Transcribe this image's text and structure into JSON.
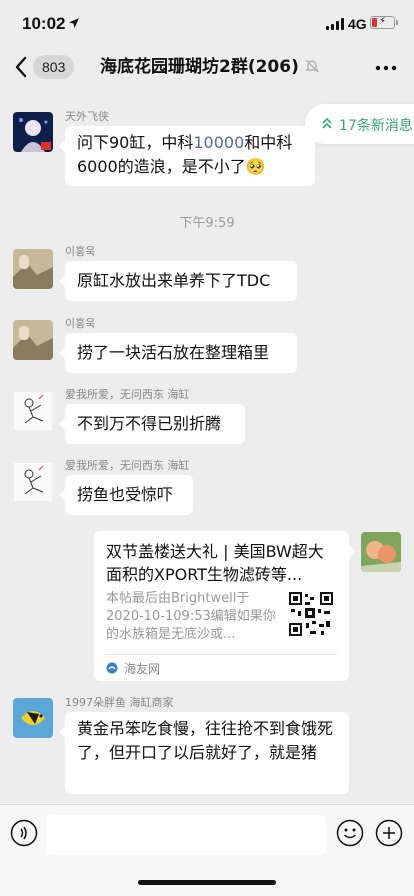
{
  "status_bar": {
    "time": "10:02",
    "network": "4G"
  },
  "nav": {
    "back_count": "803",
    "title": "海底花园珊瑚坊2群(206)"
  },
  "new_messages": {
    "label": "17条新消息"
  },
  "time_divider": "下午9:59",
  "messages": [
    {
      "sender": "天外飞侠",
      "text_parts": [
        "问下90缸，中科",
        "10000",
        "和中科6000的造浪，是不小了",
        "🥺"
      ]
    },
    {
      "sender": "이홍욱",
      "text": "原缸水放出来单养下了TDC"
    },
    {
      "sender": "이홍욱",
      "text": "捞了一块活石放在整理箱里"
    },
    {
      "sender": "爱我所爱，无问西东 海缸",
      "text": "不到万不得已别折腾"
    },
    {
      "sender": "爱我所爱，无问西东 海缸",
      "text": "捞鱼也受惊吓"
    },
    {
      "sender": "1997朵胖鱼 海缸商家",
      "text": "黄金吊笨吃食慢，往往抢不到食饿死了，但开口了以后就好了，就是猪"
    }
  ],
  "link_card": {
    "title": "双节盖楼送大礼 | 美国BW超大面积的XPORT生物滤砖等...",
    "description": "本帖最后由Brightwell于2020-10-109:53编辑如果你的水族箱是无底沙或...",
    "source": "海友网"
  },
  "input_bar": {
    "placeholder": ""
  },
  "colors": {
    "accent_green": "#3aa876",
    "link_blue": "#576b95",
    "background": "#ededed"
  }
}
